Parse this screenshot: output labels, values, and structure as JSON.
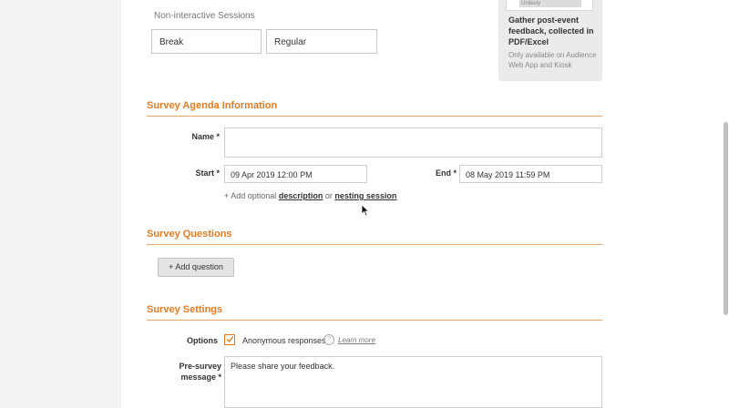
{
  "non_interactive": {
    "label": "Non-interactive Sessions",
    "sessions": [
      "Break",
      "Regular"
    ]
  },
  "tip": {
    "thumb_text": "Unlikely",
    "title": "Gather post-event feedback, collected in PDF/Excel",
    "note": "Only available on Audience Web App and Kiosk"
  },
  "agenda": {
    "title": "Survey Agenda Information",
    "name_label": "Name *",
    "name_value": "",
    "start_label": "Start *",
    "start_value": "09 Apr 2019 12:00 PM",
    "end_label": "End *",
    "end_value": "08 May 2019 11:59 PM",
    "add_prefix": "+ Add optional",
    "description_link": "description",
    "or_text": "or",
    "nesting_link": "nesting session"
  },
  "questions": {
    "title": "Survey Questions",
    "add_button": "+  Add question"
  },
  "settings": {
    "title": "Survey Settings",
    "options_label": "Options",
    "anonymous_label": "Anonymous responses",
    "anonymous_checked": true,
    "help_glyph": "?",
    "learn_more": "Learn more",
    "pre_survey_label_1": "Pre-survey",
    "pre_survey_label_2": "message *",
    "pre_survey_value": "Please share your feedback."
  },
  "colors": {
    "accent": "#e07c24",
    "page_bg": "#f3f3f3"
  }
}
